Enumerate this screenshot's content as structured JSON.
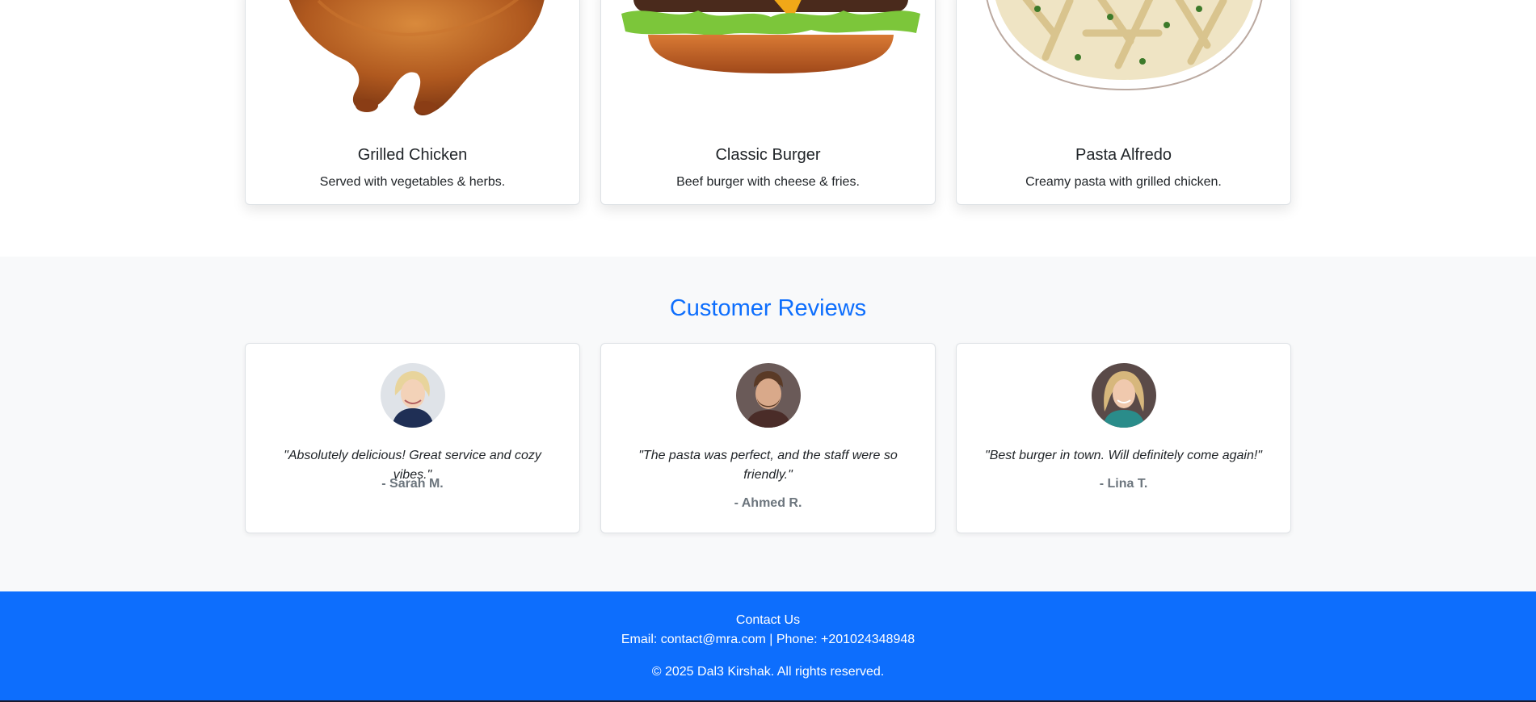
{
  "menu": {
    "items": [
      {
        "title": "Grilled Chicken",
        "description": "Served with vegetables & herbs.",
        "image": "grilled-chicken"
      },
      {
        "title": "Classic Burger",
        "description": "Beef burger with cheese & fries.",
        "image": "classic-burger"
      },
      {
        "title": "Pasta Alfredo",
        "description": "Creamy pasta with grilled chicken.",
        "image": "pasta-alfredo"
      }
    ]
  },
  "reviews": {
    "title": "Customer Reviews",
    "items": [
      {
        "quote": "\"Absolutely delicious! Great service and cozy vibes.\"",
        "author": "- Sarah M."
      },
      {
        "quote": "\"The pasta was perfect, and the staff were so friendly.\"",
        "author": "- Ahmed R."
      },
      {
        "quote": "\"Best burger in town. Will definitely come again!\"",
        "author": "- Lina T."
      }
    ]
  },
  "footer": {
    "heading": "Contact Us",
    "contact": "Email: contact@mra.com | Phone: +201024348948",
    "copyright": "© 2025 Dal3 Kirshak. All rights reserved."
  },
  "colors": {
    "primary": "#0d6efd",
    "section_bg": "#f8f9fa",
    "muted": "#6c757d"
  }
}
